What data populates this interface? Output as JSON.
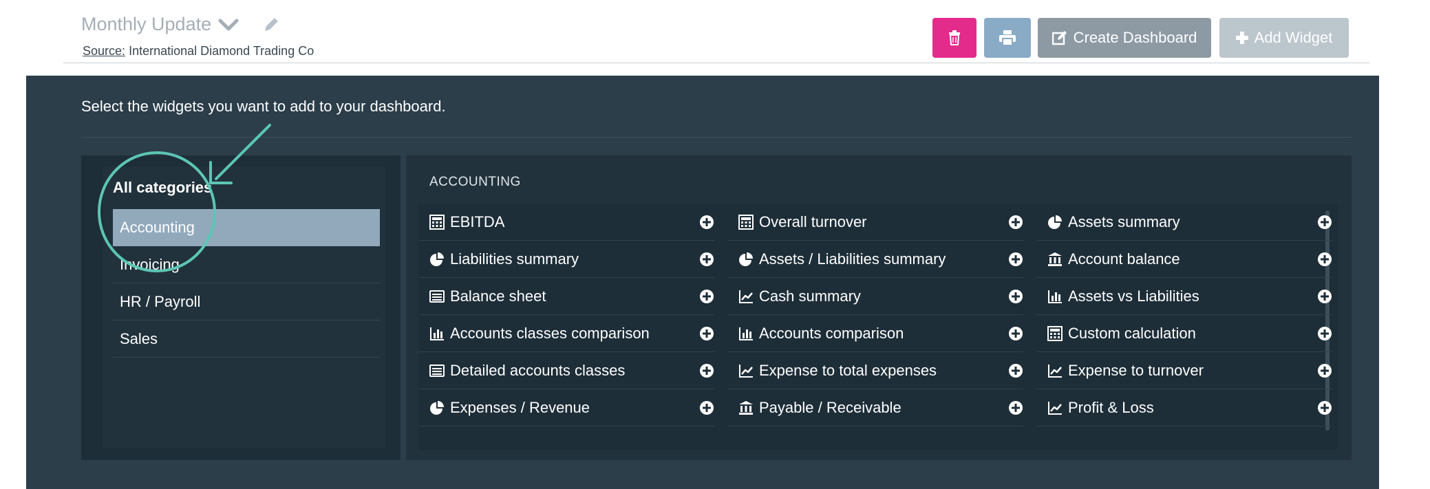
{
  "header": {
    "title": "Monthly Update",
    "source_label": "Source:",
    "source_value": "International Diamond Trading Co"
  },
  "toolbar": {
    "delete_icon": "trash-icon",
    "print_icon": "print-icon",
    "create_label": "Create Dashboard",
    "add_label": "Add Widget"
  },
  "panel": {
    "instruction": "Select the widgets you want to add to your dashboard."
  },
  "categories": {
    "title": "All categories",
    "items": [
      {
        "label": "Accounting",
        "active": true
      },
      {
        "label": "Invoicing",
        "active": false
      },
      {
        "label": "HR / Payroll",
        "active": false
      },
      {
        "label": "Sales",
        "active": false
      }
    ]
  },
  "widgets": {
    "section": "ACCOUNTING",
    "columns": [
      [
        {
          "label": "EBITDA",
          "icon": "calculator-icon"
        },
        {
          "label": "Liabilities summary",
          "icon": "pie-chart-icon"
        },
        {
          "label": "Balance sheet",
          "icon": "list-icon"
        },
        {
          "label": "Accounts classes comparison",
          "icon": "bar-chart-icon"
        },
        {
          "label": "Detailed accounts classes",
          "icon": "list-icon"
        },
        {
          "label": "Expenses / Revenue",
          "icon": "pie-chart-icon"
        }
      ],
      [
        {
          "label": "Overall turnover",
          "icon": "calculator-icon"
        },
        {
          "label": "Assets / Liabilities summary",
          "icon": "pie-chart-icon"
        },
        {
          "label": "Cash summary",
          "icon": "line-chart-icon"
        },
        {
          "label": "Accounts comparison",
          "icon": "bar-chart-icon"
        },
        {
          "label": "Expense to total expenses",
          "icon": "line-chart-icon"
        },
        {
          "label": "Payable / Receivable",
          "icon": "bank-icon"
        }
      ],
      [
        {
          "label": "Assets summary",
          "icon": "pie-chart-icon"
        },
        {
          "label": "Account balance",
          "icon": "bank-icon"
        },
        {
          "label": "Assets vs Liabilities",
          "icon": "bar-chart-icon"
        },
        {
          "label": "Custom calculation",
          "icon": "calculator-icon"
        },
        {
          "label": "Expense to turnover",
          "icon": "line-chart-icon"
        },
        {
          "label": "Profit & Loss",
          "icon": "line-chart-icon"
        }
      ]
    ]
  },
  "colors": {
    "panel": "#2b3e4a",
    "accent_teal": "#5cc6b4",
    "delete": "#e32b8c",
    "print": "#8aabc6",
    "create": "#8d9aa4",
    "add": "#bcc6cd",
    "active_category": "#92a9bc"
  }
}
